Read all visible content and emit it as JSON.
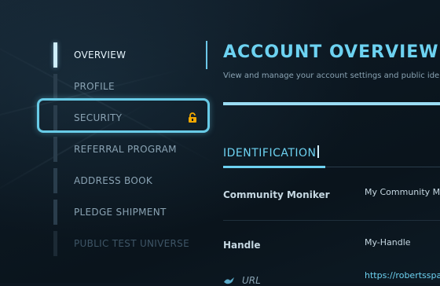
{
  "sidebar": {
    "items": [
      {
        "label": "OVERVIEW",
        "state": "active"
      },
      {
        "label": "PROFILE",
        "state": "normal"
      },
      {
        "label": "SECURITY",
        "state": "focused",
        "icon": "lock-open-icon"
      },
      {
        "label": "REFERRAL PROGRAM",
        "state": "normal"
      },
      {
        "label": "ADDRESS BOOK",
        "state": "normal"
      },
      {
        "label": "PLEDGE SHIPMENT",
        "state": "normal"
      },
      {
        "label": "PUBLIC TEST UNIVERSE",
        "state": "disabled"
      }
    ]
  },
  "main": {
    "title": "ACCOUNT OVERVIEW",
    "subtitle": "View and manage your account settings and public identifi",
    "section": {
      "title": "IDENTIFICATION",
      "fields": [
        {
          "label": "Community Moniker",
          "value": "My Community Mo"
        },
        {
          "label": "Handle",
          "value": "My-Handle"
        },
        {
          "label": "URL",
          "value": "https://robertsspa",
          "icon": "bird-icon"
        }
      ]
    }
  },
  "colors": {
    "accent": "#6dd2f1",
    "focus_ring": "#68cbe7",
    "lock_icon": "#f0a800",
    "background": "#0c1620"
  }
}
